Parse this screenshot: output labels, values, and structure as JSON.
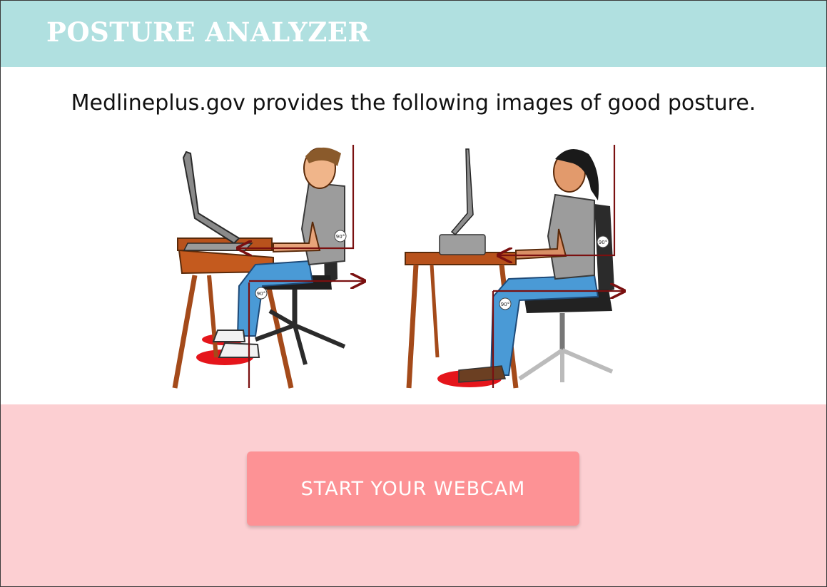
{
  "header": {
    "title": "POSTURE ANALYZER",
    "background_color": "#b0e0e0"
  },
  "intro": {
    "text": "Medlineplus.gov provides the following images of good posture."
  },
  "illustration": {
    "left_figure": {
      "subject": "man sitting at standing-height desk with laptop on stand",
      "angle_labels": [
        "90°",
        "90°"
      ]
    },
    "right_figure": {
      "subject": "woman sitting at desk with monitor, ergonomic chair",
      "angle_labels": [
        "90°",
        "90°"
      ]
    }
  },
  "actions": {
    "webcam_button_label": "START YOUR WEBCAM",
    "button_color": "#fd9295",
    "section_color": "#fccfd2"
  }
}
